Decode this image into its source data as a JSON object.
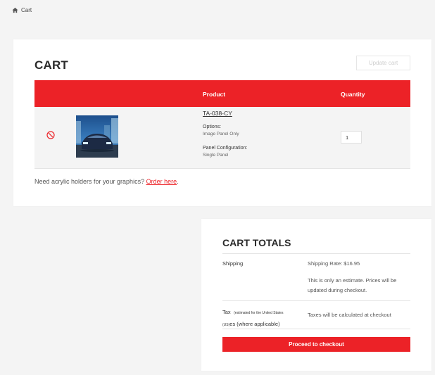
{
  "breadcrumb": {
    "home_icon": "home-icon",
    "current": "Cart"
  },
  "cart": {
    "title": "CART",
    "update_label": "Update cart",
    "columns": {
      "product": "Product",
      "quantity": "Quantity"
    },
    "items": [
      {
        "remove_icon": "remove-circle-icon",
        "sku": "TA-038-CY",
        "options_label": "Options:",
        "options_value": "Image Panel Only",
        "panel_config_label": "Panel Configuration:",
        "panel_config_value": "Single Panel",
        "quantity": "1"
      }
    ],
    "acrylic_prefix": "Need acrylic holders for your graphics? ",
    "acrylic_link": "Order here",
    "acrylic_suffix": "."
  },
  "totals": {
    "title": "CART TOTALS",
    "shipping_label": "Shipping",
    "shipping_rate": "Shipping Rate: $16.95",
    "shipping_note": "This is only an estimate. Prices will be updated during checkout.",
    "tax_label_prefix": "Tax",
    "tax_label_small_1": "(estimated for the United States",
    "tax_label_small_2": "(US)",
    "tax_label_suffix": "es (where applicable)",
    "tax_value": "Taxes will be calculated at checkout",
    "checkout_label": "Proceed to checkout"
  },
  "colors": {
    "accent": "#ec2227",
    "background": "#f4f4f4"
  }
}
